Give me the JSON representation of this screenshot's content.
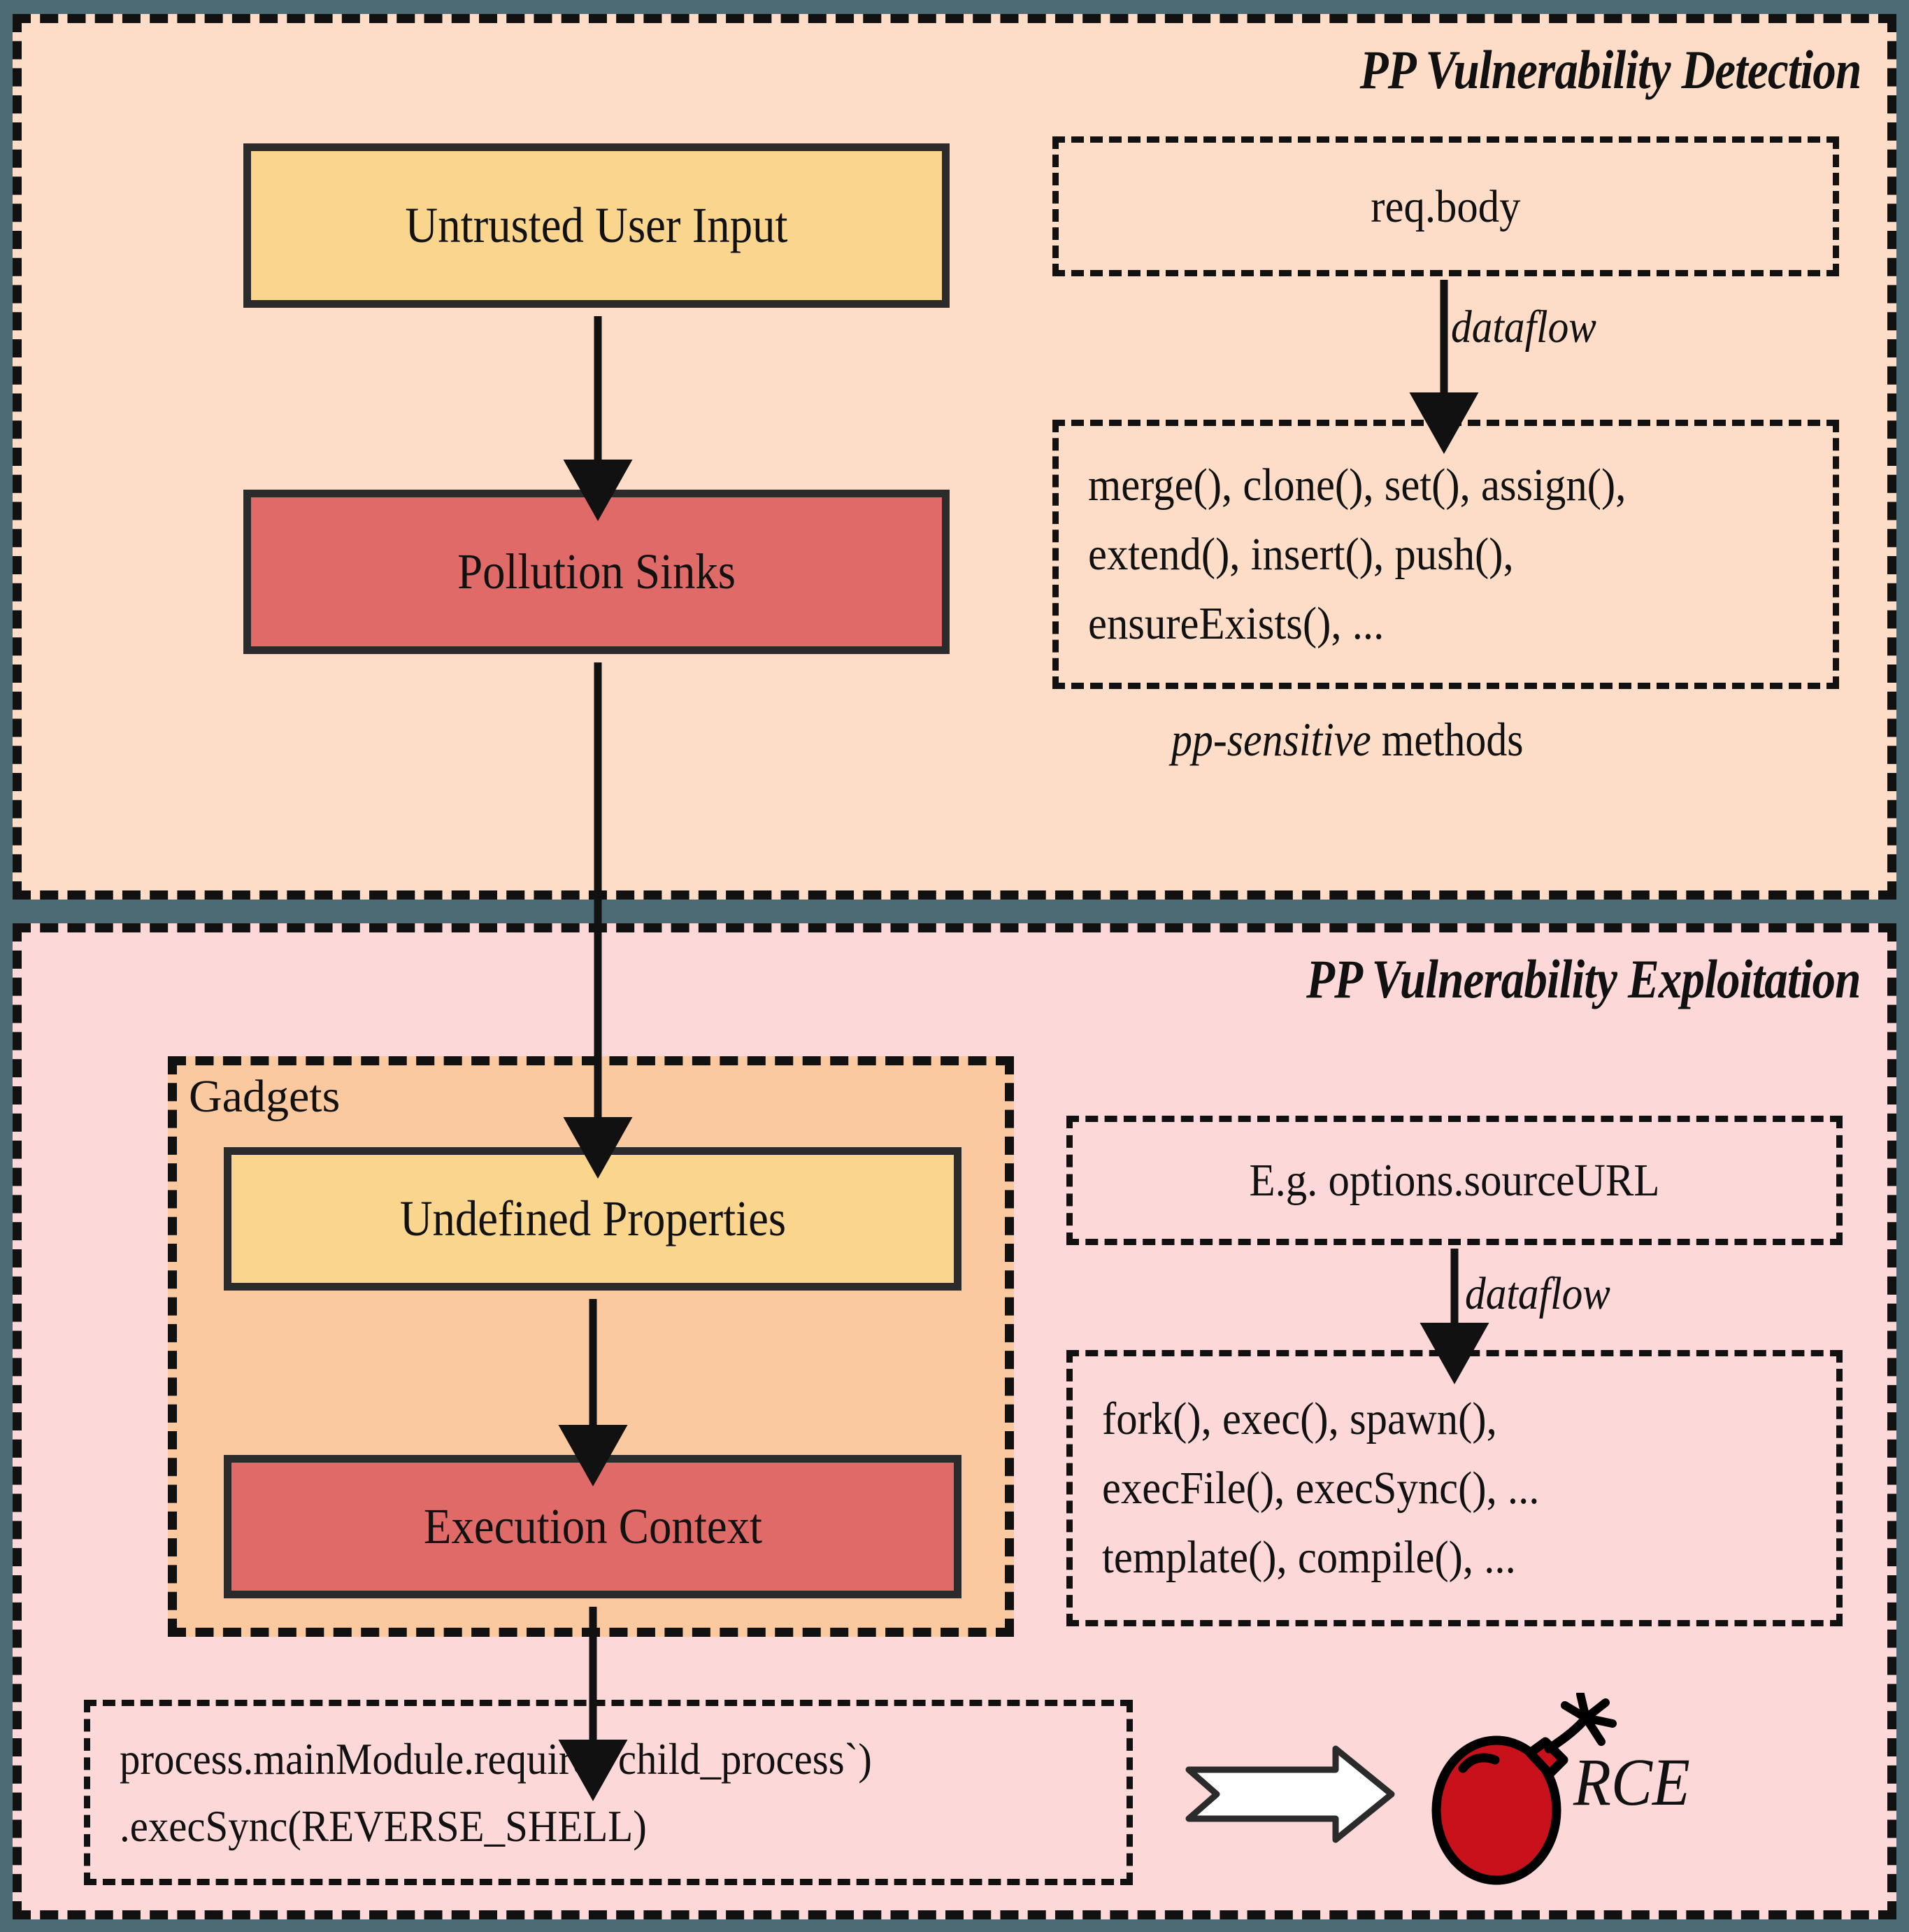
{
  "panels": {
    "detection": {
      "title": "PP Vulnerability Detection",
      "nodes": {
        "untrusted_input": "Untrusted User Input",
        "pollution_sinks": "Pollution Sinks"
      },
      "source_box": "req.body",
      "dataflow_label": "dataflow",
      "methods_lines": [
        "merge(), clone(), set(), assign(),",
        "extend(), insert(), push(),",
        "ensureExists(), ..."
      ],
      "methods_caption_italic": "pp-sensitive",
      "methods_caption_rest": " methods"
    },
    "exploitation": {
      "title": "PP Vulnerability Exploitation",
      "gadgets_label": "Gadgets",
      "nodes": {
        "undefined_properties": "Undefined Properties",
        "execution_context": "Execution Context"
      },
      "source_box": "E.g. options.sourceURL",
      "dataflow_label": "dataflow",
      "methods_lines": [
        "fork(), exec(), spawn(),",
        "execFile(), execSync(), ...",
        "template(), compile(), ..."
      ],
      "payload_lines": [
        "process.mainModule.require(`child_process`)",
        ".execSync(REVERSE_SHELL)"
      ],
      "outcome_label": "RCE"
    }
  },
  "colors": {
    "background_slate": "#4d6b75",
    "panel_detection_bg": "#fddcc8",
    "panel_exploit_bg": "#fcd8d8",
    "gadgets_panel_bg": "#fbc9a0",
    "node_yellow": "#fad58e",
    "node_red": "#e06a68",
    "node_border": "#2b2b2b",
    "bomb_red": "#c8111a",
    "stroke_black": "#111111"
  },
  "icons": {
    "bomb": "bomb-icon",
    "block_arrow": "block-arrow-right-icon"
  }
}
